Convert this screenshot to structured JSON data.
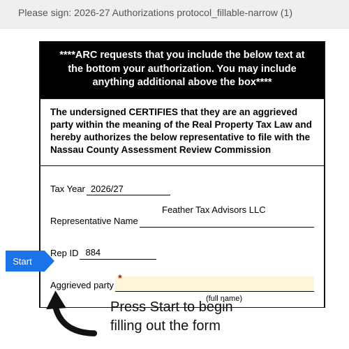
{
  "topbar": {
    "prompt": "Please sign: 2026-27 Authorizations protocol_fillable-narrow (1)"
  },
  "doc": {
    "black_header": "****ARC requests that you include the below text at the bottom your authorization. You may include anything additional above the box****",
    "certification": "The undersigned CERTIFIES that they are an aggrieved party within the meaning of the Real Property Tax Law and hereby authorizes the below representative to file with the Nassau County Assessment Review Commission",
    "fields": {
      "tax_year": {
        "label": "Tax Year",
        "value": "2026/27"
      },
      "rep_name": {
        "label": "Representative Name",
        "value": "Feather Tax Advisors LLC"
      },
      "rep_id": {
        "label": "Rep ID",
        "value": "884"
      },
      "aggrieved": {
        "label": "Aggrieved party",
        "required_marker": "*",
        "value": "",
        "caption": "(full name)"
      }
    }
  },
  "start_tag": {
    "label": "Start"
  },
  "hint": {
    "text_line1": "Press Start to begin",
    "text_line2": "filling out the form"
  }
}
